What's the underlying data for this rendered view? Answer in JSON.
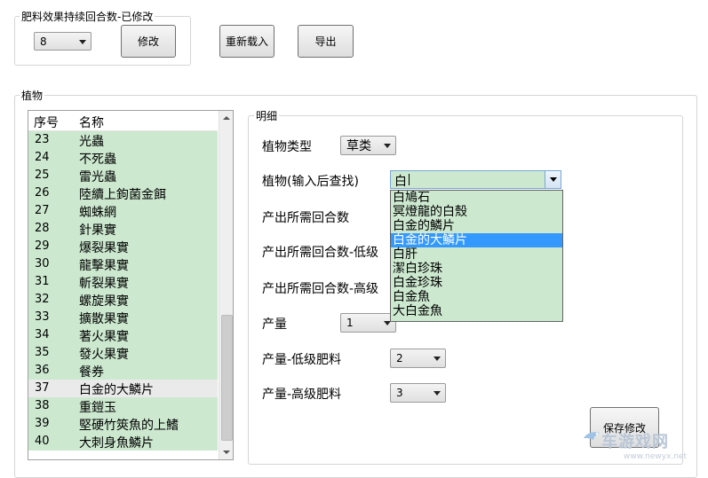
{
  "fertilizer": {
    "group_title": "肥料效果持续回合数-已修改",
    "select_value": "8",
    "modify_label": "修改",
    "reload_label": "重新载入",
    "export_label": "导出"
  },
  "plants": {
    "group_title": "植物",
    "headers": {
      "index": "序号",
      "name": "名称"
    },
    "rows": [
      {
        "index": "23",
        "name": "光蟲"
      },
      {
        "index": "24",
        "name": "不死蟲"
      },
      {
        "index": "25",
        "name": "雷光蟲"
      },
      {
        "index": "26",
        "name": "陸續上鉤菌金餌"
      },
      {
        "index": "27",
        "name": "蜘蛛網"
      },
      {
        "index": "28",
        "name": "針果實"
      },
      {
        "index": "29",
        "name": "爆裂果實"
      },
      {
        "index": "30",
        "name": "龍擊果實"
      },
      {
        "index": "31",
        "name": "斬裂果實"
      },
      {
        "index": "32",
        "name": "螺旋果實"
      },
      {
        "index": "33",
        "name": "擴散果實"
      },
      {
        "index": "34",
        "name": "著火果實"
      },
      {
        "index": "35",
        "name": "發火果實"
      },
      {
        "index": "36",
        "name": "餐券"
      },
      {
        "index": "37",
        "name": "白金的大鱗片"
      },
      {
        "index": "38",
        "name": "重鎧玉"
      },
      {
        "index": "39",
        "name": "堅硬竹筴魚的上鰭"
      },
      {
        "index": "40",
        "name": "大刺身魚鱗片"
      }
    ],
    "selected_index": "37"
  },
  "detail": {
    "group_title": "明细",
    "plant_type_label": "植物类型",
    "plant_type_value": "草类",
    "plant_search_label": "植物(输入后查找)",
    "plant_search_value": "白",
    "search_options": [
      "白鳩石",
      "冥燈龍的白殼",
      "白金的鱗片",
      "白金的大鱗片",
      "白肝",
      "潔白珍珠",
      "白金珍珠",
      "白金魚",
      "大白金魚"
    ],
    "highlighted_option": "白金的大鱗片",
    "rounds_label": "产出所需回合数",
    "rounds_low_label": "产出所需回合数-低级",
    "rounds_high_label": "产出所需回合数-高级",
    "yield_label": "产量",
    "yield_value": "1",
    "yield_low_label": "产量-低级肥料",
    "yield_low_value": "2",
    "yield_high_label": "产量-高级肥料",
    "yield_high_value": "3",
    "save_label": "保存修改"
  },
  "watermark": {
    "text": "车游戏网",
    "url": "www.newyx.net"
  }
}
